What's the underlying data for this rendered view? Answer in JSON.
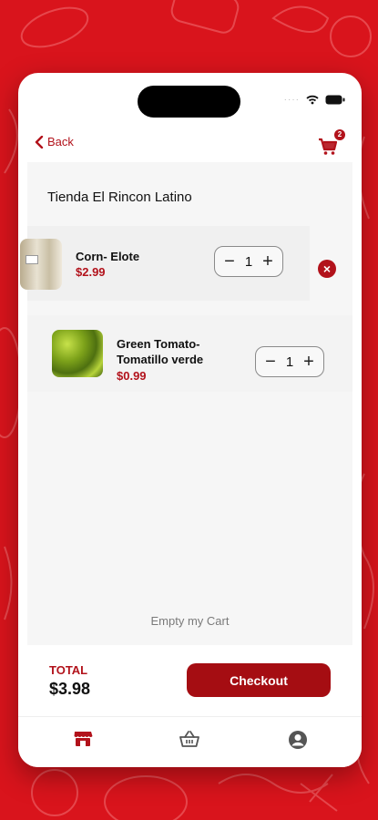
{
  "nav": {
    "back_label": "Back",
    "cart_count": "2"
  },
  "store": {
    "name": "Tienda El Rincon Latino"
  },
  "cart_items": [
    {
      "name_line1": "Corn- Elote",
      "name_line2": "",
      "price": "$2.99",
      "quantity": "1"
    },
    {
      "name_line1": "Green Tomato-",
      "name_line2": "Tomatillo verde",
      "price": "$0.99",
      "quantity": "1"
    }
  ],
  "actions": {
    "empty_cart": "Empty my Cart",
    "checkout": "Checkout",
    "stepper_minus": "−",
    "stepper_plus": "+",
    "remove": "×"
  },
  "summary": {
    "total_label": "TOTAL",
    "total_value": "$3.98"
  },
  "tabs": [
    {
      "icon": "store-icon",
      "active": true
    },
    {
      "icon": "basket-icon",
      "active": false
    },
    {
      "icon": "account-icon",
      "active": false
    }
  ],
  "colors": {
    "brand": "#b2121b",
    "background": "#d9141c"
  }
}
